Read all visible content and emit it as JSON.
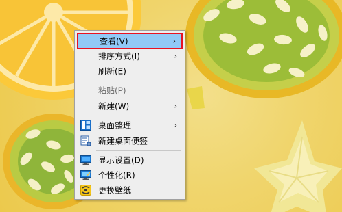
{
  "context_menu": {
    "items": [
      {
        "label": "查看(V)",
        "submenu": true,
        "highlighted": true
      },
      {
        "label": "排序方式(I)",
        "submenu": true
      },
      {
        "label": "刷新(E)"
      },
      {
        "label": "粘贴(P)",
        "disabled": true
      },
      {
        "label": "新建(W)",
        "submenu": true
      },
      {
        "label": "桌面整理",
        "submenu": true,
        "icon": "desktop-organize-icon"
      },
      {
        "label": "新建桌面便签",
        "icon": "sticky-note-icon"
      },
      {
        "label": "显示设置(D)",
        "icon": "display-monitor-icon"
      },
      {
        "label": "个性化(R)",
        "icon": "personalize-monitor-icon"
      },
      {
        "label": "更换壁纸",
        "icon": "wallpaper-change-icon"
      }
    ],
    "submenu_arrow": "›"
  },
  "colors": {
    "menu_background": "#eeeeee",
    "highlight_background": "#91c9f7",
    "highlight_border": "#e81123",
    "disabled_text": "#6d6d6d"
  },
  "wallpaper": {
    "subject": "citrus-and-kiwano-fruit-slices",
    "background": "#f0d56d"
  }
}
